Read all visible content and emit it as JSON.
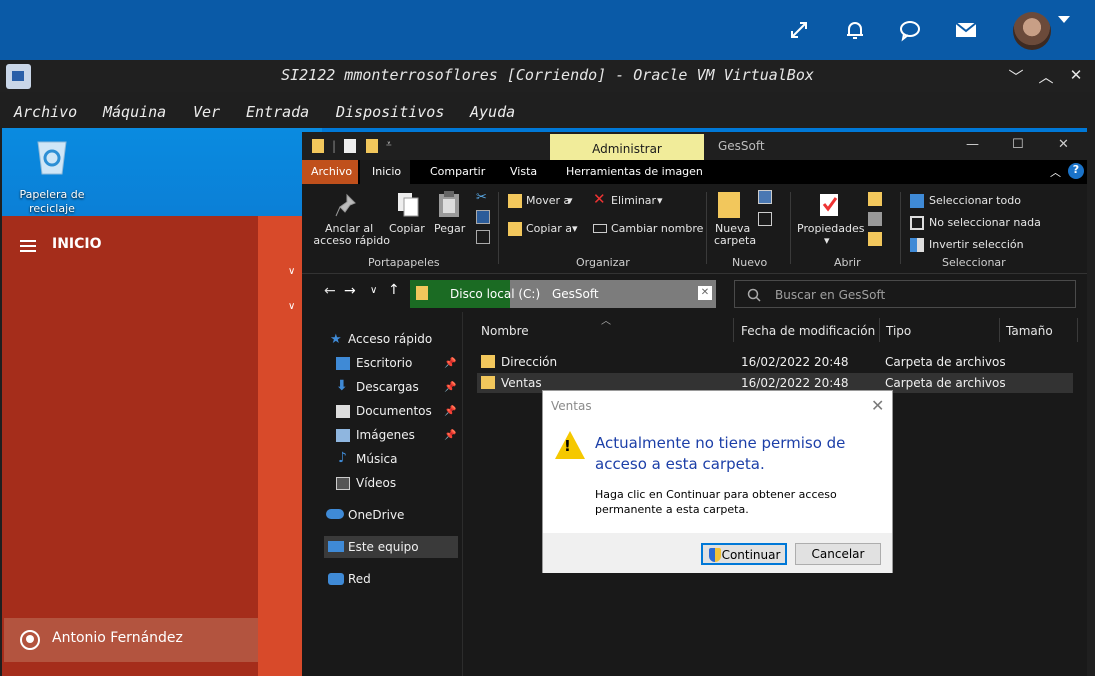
{
  "host": {
    "icons": [
      "expand-icon",
      "bell-icon",
      "chat-icon",
      "mail-icon"
    ]
  },
  "vbox": {
    "title": "SI2122 mmonterrosoflores [Corriendo] - Oracle VM VirtualBox",
    "menu": [
      "Archivo",
      "Máquina",
      "Ver",
      "Entrada",
      "Dispositivos",
      "Ayuda"
    ]
  },
  "desktop": {
    "recycle_bin": "Papelera de reciclaje"
  },
  "start": {
    "title": "INICIO",
    "user": "Antonio Fernández"
  },
  "explorer": {
    "admin_tab": "Administrar",
    "title": "GesSoft",
    "tabs": {
      "archivo": "Archivo",
      "inicio": "Inicio",
      "compartir": "Compartir",
      "vista": "Vista",
      "herramientas": "Herramientas de imagen"
    },
    "ribbon": {
      "anclar_1": "Anclar al",
      "anclar_2": "acceso rápido",
      "copiar": "Copiar",
      "pegar": "Pegar",
      "mover": "Mover a",
      "copiar_a": "Copiar a",
      "eliminar": "Eliminar",
      "cambiar": "Cambiar nombre",
      "nueva_1": "Nueva",
      "nueva_2": "carpeta",
      "propiedades": "Propiedades",
      "sel_todo": "Seleccionar todo",
      "no_sel": "No seleccionar nada",
      "invertir": "Invertir selección",
      "groups": {
        "portapapeles": "Portapapeles",
        "organizar": "Organizar",
        "nuevo": "Nuevo",
        "abrir": "Abrir",
        "seleccionar": "Seleccionar"
      }
    },
    "address": {
      "segment1": "Disco local (C:)",
      "segment2": "GesSoft",
      "search_placeholder": "Buscar en GesSoft"
    },
    "nav": {
      "acceso": "Acceso rápido",
      "escritorio": "Escritorio",
      "descargas": "Descargas",
      "documentos": "Documentos",
      "imagenes": "Imágenes",
      "musica": "Música",
      "videos": "Vídeos",
      "onedrive": "OneDrive",
      "este_equipo": "Este equipo",
      "red": "Red"
    },
    "columns": {
      "nombre": "Nombre",
      "fecha": "Fecha de modificación",
      "tipo": "Tipo",
      "tamano": "Tamaño"
    },
    "rows": [
      {
        "name": "Dirección",
        "date": "16/02/2022 20:48",
        "type": "Carpeta de archivos"
      },
      {
        "name": "Ventas",
        "date": "16/02/2022 20:48",
        "type": "Carpeta de archivos"
      }
    ]
  },
  "dialog": {
    "title": "Ventas",
    "heading": "Actualmente no tiene permiso de acceso a esta carpeta.",
    "body": "Haga clic en Continuar para obtener acceso permanente a esta carpeta.",
    "continue": "Continuar",
    "cancel": "Cancelar"
  }
}
